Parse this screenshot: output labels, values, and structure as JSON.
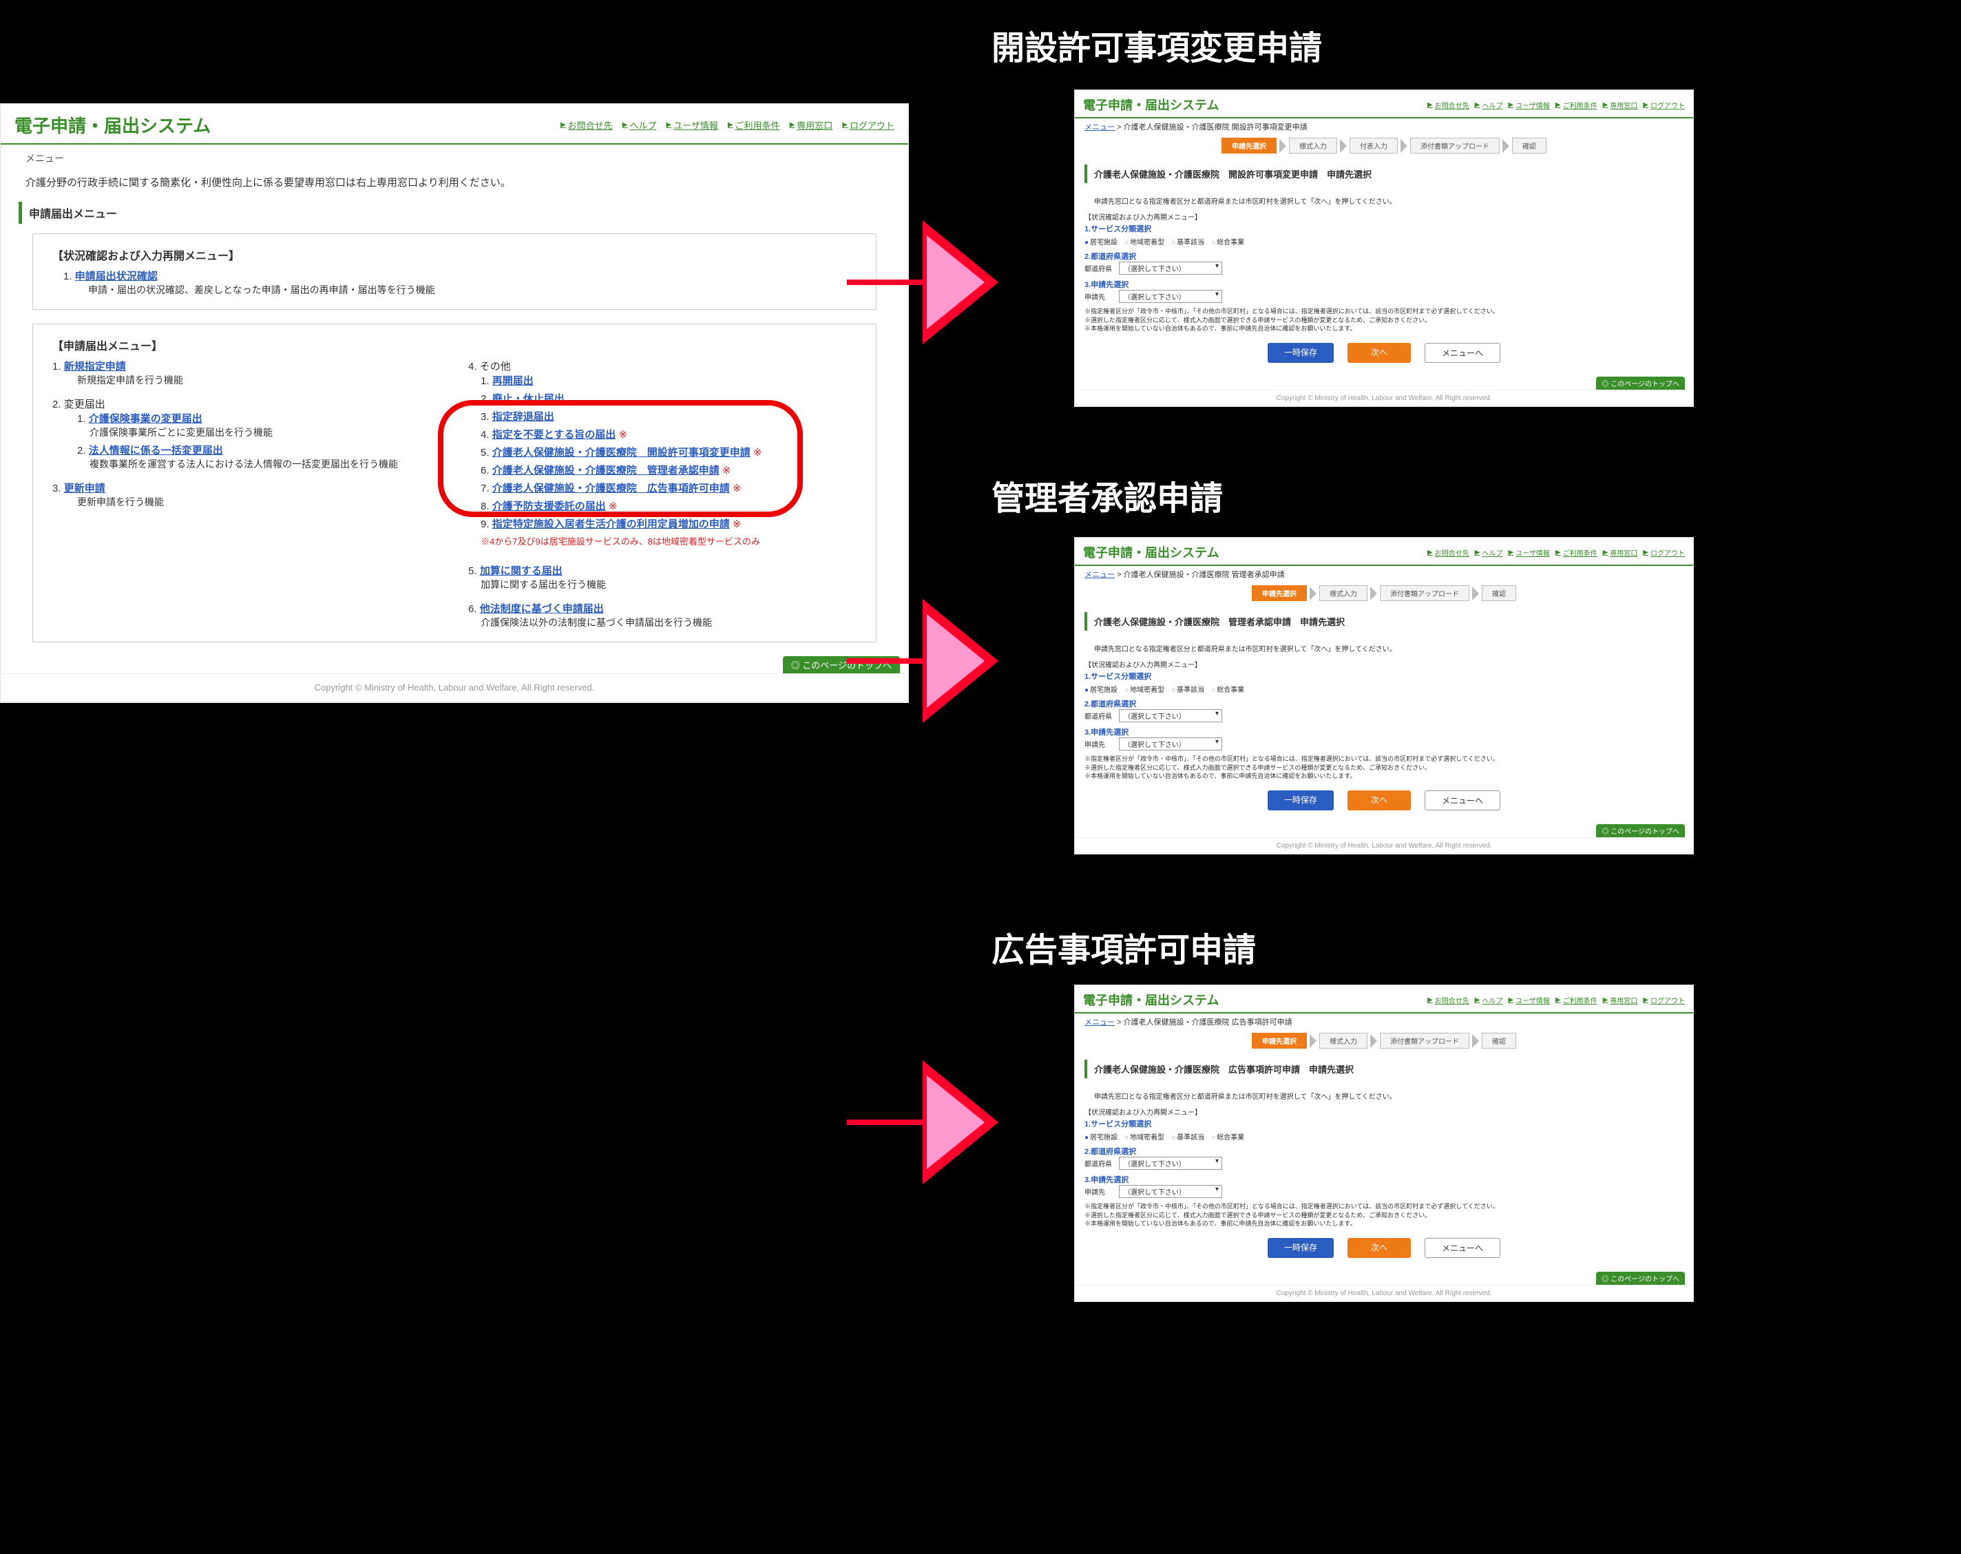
{
  "main": {
    "app_title": "電子申請・届出システム",
    "util_links": [
      "お問合せ先",
      "ヘルプ",
      "ユーザ情報",
      "ご利用条件",
      "専用窓口",
      "ログアウト"
    ],
    "menu_label": "メニュー",
    "intro_text": "介護分野の行政手続に関する簡素化・利便性向上に係る要望専用窓口は右上専用窓口より利用ください。",
    "section_heading": "申請届出メニュー",
    "status_box": {
      "group_title": "【状況確認および入力再開メニュー】",
      "item_num": "1.",
      "item_link": "申請届出状況確認",
      "item_desc": "申請・届出の状況確認、差戻しとなった申請・届出の再申請・届出等を行う機能"
    },
    "menu_box": {
      "group_title": "【申請届出メニュー】",
      "left": [
        {
          "num": "1.",
          "link": "新規指定申請",
          "desc": "新規指定申請を行う機能"
        },
        {
          "num": "2.",
          "label": "変更届出",
          "subs": [
            {
              "num": "1.",
              "link": "介護保険事業の変更届出",
              "desc": "介護保険事業所ごとに変更届出を行う機能"
            },
            {
              "num": "2.",
              "link": "法人情報に係る一括変更届出",
              "desc": "複数事業所を運営する法人における法人情報の一括変更届出を行う機能"
            }
          ]
        },
        {
          "num": "3.",
          "link": "更新申請",
          "desc": "更新申請を行う機能"
        }
      ],
      "right_header": {
        "num": "4.",
        "label": "その他"
      },
      "right_subs": [
        {
          "num": "1.",
          "link": "再開届出"
        },
        {
          "num": "2.",
          "link": "廃止・休止届出"
        },
        {
          "num": "3.",
          "link": "指定辞退届出"
        },
        {
          "num": "4.",
          "link": "指定を不要とする旨の届出",
          "mark": "※"
        },
        {
          "num": "5.",
          "link": "介護老人保健施設・介護医療院　開設許可事項変更申請",
          "mark": "※"
        },
        {
          "num": "6.",
          "link": "介護老人保健施設・介護医療院　管理者承認申請",
          "mark": "※"
        },
        {
          "num": "7.",
          "link": "介護老人保健施設・介護医療院　広告事項許可申請",
          "mark": "※"
        },
        {
          "num": "8.",
          "link": "介護予防支援委託の届出",
          "mark": "※"
        },
        {
          "num": "9.",
          "link": "指定特定施設入居者生活介護の利用定員増加の申請",
          "mark": "※"
        }
      ],
      "right_note": "※4から7及び9は居宅施設サービスのみ、8は地域密着型サービスのみ",
      "right_extra": [
        {
          "num": "5.",
          "link": "加算に関する届出",
          "desc": "加算に関する届出を行う機能"
        },
        {
          "num": "6.",
          "link": "他法制度に基づく申請届出",
          "desc": "介護保険法以外の法制度に基づく申請届出を行う機能"
        }
      ]
    },
    "page_top": "このページのトップへ",
    "copyright": "Copyright © Ministry of Health, Labour and Welfare, All Right reserved."
  },
  "panels": [
    {
      "title": "開設許可事項変更申請",
      "breadcrumb_prefix": "メニュー",
      "breadcrumb_rest": " > 介護老人保健施設・介護医療院 開設許可事項変更申請",
      "steps": [
        "申請先選択",
        "様式入力",
        "付表入力",
        "添付書類アップロード",
        "確認"
      ],
      "section_heading": "介護老人保健施設・介護医療院　開設許可事項変更申請　申請先選択",
      "intro": "申請先窓口となる指定権者区分と都道府県または市区町村を選択して「次へ」を押してください。",
      "reopen_label": "【状況確認および入力再開メニュー】",
      "svc_label": "1.サービス分類選択",
      "svc_options": [
        "居宅施設",
        "地域密着型",
        "基準該当",
        "総合事業"
      ],
      "pref_label": "2.都道府県選択",
      "pref_field": "都道府県",
      "pref_value": "（選択して下さい）",
      "dest_label": "3.申請先選択",
      "dest_field": "申請先",
      "dest_value": "（選択して下さい）",
      "notes": [
        "※指定権者区分が「政令市・中核市」、「その他の市区町村」となる場合には、指定権者選択においては、該当の市区町村まで必ず選択してください。",
        "※選択した指定権者区分に応じて、様式入力画面で選択できる申請サービスの種類が変更となるため、ご承知おきください。",
        "※本格運用を開始していない自治体もあるので、事前に申請先自治体に確認をお願いいたします。"
      ],
      "buttons": [
        "一時保存",
        "次へ",
        "メニューへ"
      ]
    },
    {
      "title": "管理者承認申請",
      "breadcrumb_prefix": "メニュー",
      "breadcrumb_rest": " > 介護老人保健施設・介護医療院 管理者承認申請",
      "steps": [
        "申請先選択",
        "様式入力",
        "添付書類アップロード",
        "確認"
      ],
      "section_heading": "介護老人保健施設・介護医療院　管理者承認申請　申請先選択",
      "intro": "申請先窓口となる指定権者区分と都道府県または市区町村を選択して「次へ」を押してください。",
      "reopen_label": "【状況確認および入力再開メニュー】",
      "svc_label": "1.サービス分類選択",
      "svc_options": [
        "居宅施設",
        "地域密着型",
        "基準該当",
        "総合事業"
      ],
      "pref_label": "2.都道府県選択",
      "pref_field": "都道府県",
      "pref_value": "（選択して下さい）",
      "dest_label": "3.申請先選択",
      "dest_field": "申請先",
      "dest_value": "（選択して下さい）",
      "notes": [
        "※指定権者区分が「政令市・中核市」、「その他の市区町村」となる場合には、指定権者選択においては、該当の市区町村まで必ず選択してください。",
        "※選択した指定権者区分に応じて、様式入力画面で選択できる申請サービスの種類が変更となるため、ご承知おきください。",
        "※本格運用を開始していない自治体もあるので、事前に申請先自治体に確認をお願いいたします。"
      ],
      "buttons": [
        "一時保存",
        "次へ",
        "メニューへ"
      ]
    },
    {
      "title": "広告事項許可申請",
      "breadcrumb_prefix": "メニュー",
      "breadcrumb_rest": " > 介護老人保健施設・介護医療院 広告事項許可申請",
      "steps": [
        "申請先選択",
        "様式入力",
        "添付書類アップロード",
        "確認"
      ],
      "section_heading": "介護老人保健施設・介護医療院　広告事項許可申請　申請先選択",
      "intro": "申請先窓口となる指定権者区分と都道府県または市区町村を選択して「次へ」を押してください。",
      "reopen_label": "【状況確認および入力再開メニュー】",
      "svc_label": "1.サービス分類選択",
      "svc_options": [
        "居宅施設",
        "地域密着型",
        "基準該当",
        "総合事業"
      ],
      "pref_label": "2.都道府県選択",
      "pref_field": "都道府県",
      "pref_value": "（選択して下さい）",
      "dest_label": "3.申請先選択",
      "dest_field": "申請先",
      "dest_value": "（選択して下さい）",
      "notes": [
        "※指定権者区分が「政令市・中核市」、「その他の市区町村」となる場合には、指定権者選択においては、該当の市区町村まで必ず選択してください。",
        "※選択した指定権者区分に応じて、様式入力画面で選択できる申請サービスの種類が変更となるため、ご承知おきください。",
        "※本格運用を開始していない自治体もあるので、事前に申請先自治体に確認をお願いいたします。"
      ],
      "buttons": [
        "一時保存",
        "次へ",
        "メニューへ"
      ]
    }
  ]
}
